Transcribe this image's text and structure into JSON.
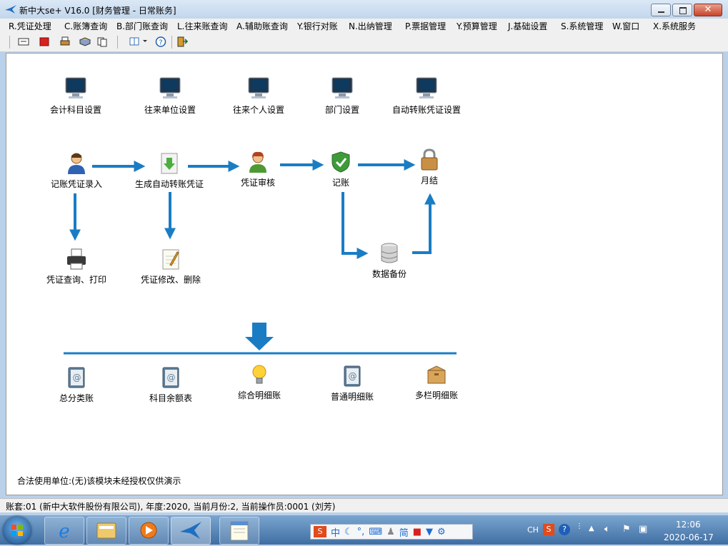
{
  "window": {
    "title": "新中大se+ V16.0 [财务管理 - 日常账务]"
  },
  "menu": [
    "R.凭证处理",
    "C.账簿查询",
    "B.部门账查询",
    "L.往来账查询",
    "A.辅助账查询",
    "Y.银行对账",
    "N.出纳管理",
    "P.票据管理",
    "Y.预算管理",
    "J.基础设置",
    "S.系统管理",
    "W.窗口",
    "X.系统服务"
  ],
  "setup": {
    "accounts": "会计科目设置",
    "units": "往来单位设置",
    "persons": "往来个人设置",
    "departments": "部门设置",
    "auto_transfer": "自动转账凭证设置"
  },
  "flow": {
    "entry": "记账凭证录入",
    "generate": "生成自动转账凭证",
    "audit": "凭证审核",
    "post": "记账",
    "close": "月结",
    "query_print": "凭证查询、打印",
    "modify_delete": "凭证修改、删除",
    "backup": "数据备份"
  },
  "ledgers": {
    "general": "总分类账",
    "balance": "科目余额表",
    "summary_detail": "综合明细账",
    "normal_detail": "普通明细账",
    "multi_detail": "多栏明细账"
  },
  "license": "合法使用单位:(无)该模块未经授权仅供演示",
  "status": "账套:01 (新中大软件股份有限公司), 年度:2020, 当前月份:2, 当前操作员:0001 (刘芳)",
  "taskbar": {
    "ime_lang": "CH",
    "ime_items": [
      "中",
      "简"
    ],
    "time": "12:06",
    "date": "2020-06-17"
  },
  "colors": {
    "arrow": "#1a7dc4",
    "titlebar": "#c2d6ec",
    "desktop": "#b9d1ea"
  }
}
